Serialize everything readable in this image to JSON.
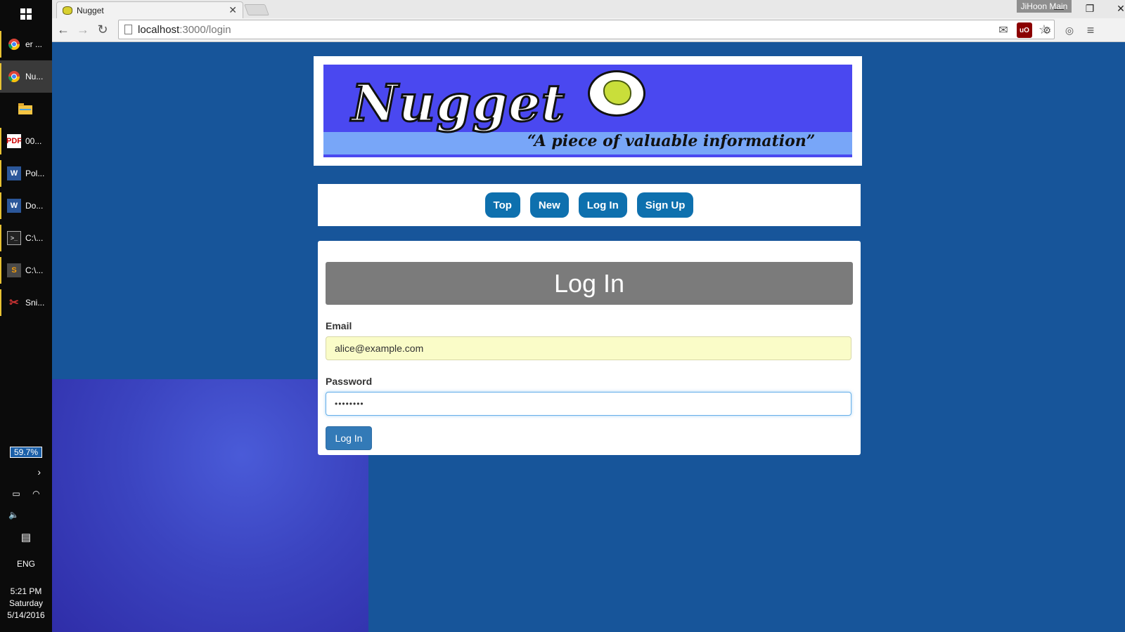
{
  "taskbar": {
    "items": [
      {
        "label": "er ...",
        "icon": "chrome-icon"
      },
      {
        "label": "Nu...",
        "icon": "chrome-icon"
      },
      {
        "label": "",
        "icon": "file-explorer-icon"
      },
      {
        "label": "00...",
        "icon": "pdf-icon"
      },
      {
        "label": "Pol...",
        "icon": "word-icon"
      },
      {
        "label": "Do...",
        "icon": "word-icon"
      },
      {
        "label": "C:\\...",
        "icon": "terminal-icon"
      },
      {
        "label": "C:\\...",
        "icon": "sublime-icon"
      },
      {
        "label": "Sni...",
        "icon": "snipping-tool-icon"
      }
    ],
    "battery": "59.7%",
    "language": "ENG",
    "time": "5:21 PM",
    "day": "Saturday",
    "date": "5/14/2016"
  },
  "browser": {
    "tab_title": "Nugget",
    "profile_name": "JiHoon Main",
    "url_host": "localhost",
    "url_path": ":3000/login"
  },
  "banner": {
    "logo_text": "Nugget",
    "tagline": "“A piece of valuable information”"
  },
  "nav": {
    "top": "Top",
    "new": "New",
    "login": "Log In",
    "signup": "Sign Up"
  },
  "login": {
    "heading": "Log In",
    "email_label": "Email",
    "email_value": "alice@example.com",
    "password_label": "Password",
    "password_value": "••••••••",
    "submit": "Log In"
  },
  "colors": {
    "page_bg": "#17559a",
    "nav_button": "#0e70ae",
    "submit_button": "#337ab7",
    "heading_bg": "#7b7b7b",
    "banner_bg": "#4a48f0"
  }
}
